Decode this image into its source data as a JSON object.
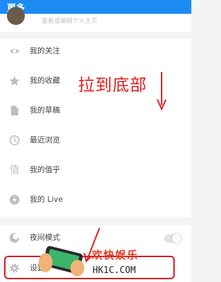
{
  "header": {
    "title": "更多"
  },
  "profile": {
    "subtitle": "查看或编辑个人主页"
  },
  "menu": {
    "items": [
      {
        "label": "我的关注",
        "icon": "eye-icon"
      },
      {
        "label": "我的收藏",
        "icon": "star-icon"
      },
      {
        "label": "我的草稿",
        "icon": "document-icon"
      },
      {
        "label": "最近浏览",
        "icon": "clock-icon"
      },
      {
        "label": "我的值乎",
        "icon": "zhihu-value-icon",
        "glyph": "值"
      },
      {
        "label": "我的 Live",
        "icon": "lightning-icon"
      }
    ]
  },
  "bottom": {
    "night_mode": {
      "label": "夜间模式",
      "icon": "moon-icon",
      "enabled": false
    },
    "settings": {
      "label": "设置",
      "icon": "gear-icon"
    }
  },
  "annotation": {
    "text": "拉到底部"
  },
  "watermark": {
    "brand": "欢快娱乐",
    "url": "HK1C.COM"
  },
  "colors": {
    "header": "#1c8cf4",
    "annotation": "#e01e1e",
    "icon": "#bdbdbd"
  }
}
